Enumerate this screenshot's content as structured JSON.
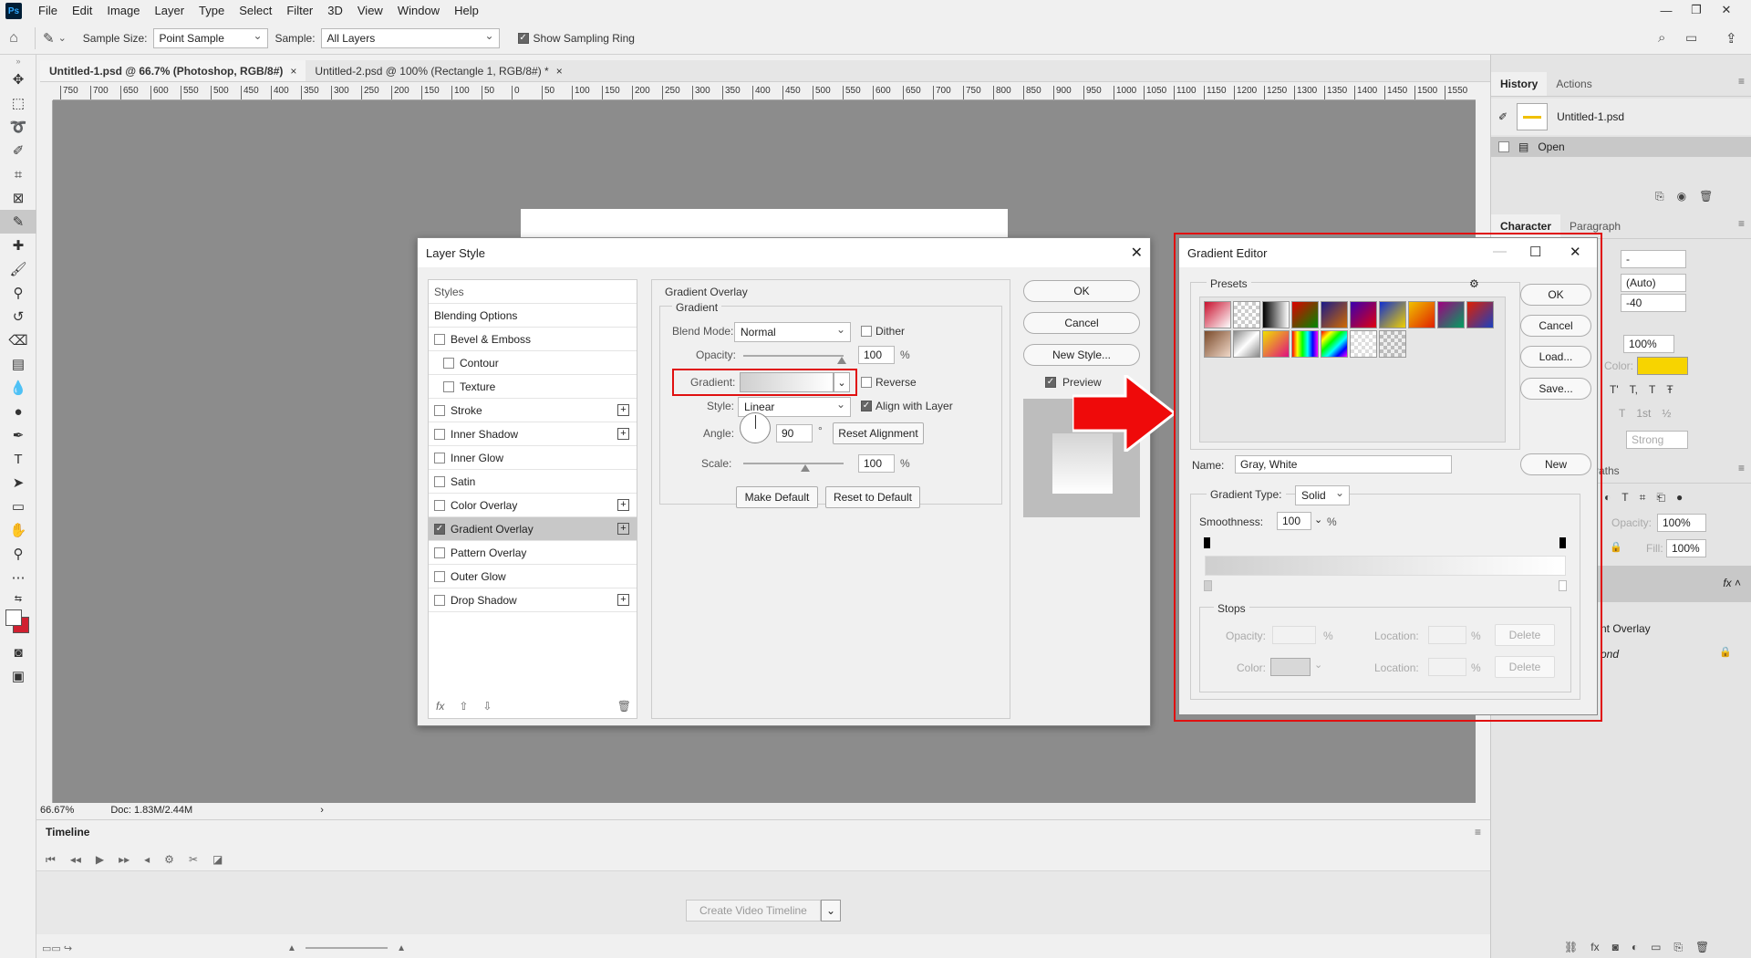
{
  "app": {
    "logo": "Ps",
    "menu": [
      "File",
      "Edit",
      "Image",
      "Layer",
      "Type",
      "Select",
      "Filter",
      "3D",
      "View",
      "Window",
      "Help"
    ]
  },
  "options_bar": {
    "sample_size_label": "Sample Size:",
    "sample_size_value": "Point Sample",
    "sample_label": "Sample:",
    "sample_value": "All Layers",
    "show_sampling_ring": "Show Sampling Ring"
  },
  "tabs": [
    {
      "label": "Untitled-1.psd @ 66.7% (Photoshop, RGB/8#)",
      "close": "×"
    },
    {
      "label": "Untitled-2.psd @ 100% (Rectangle 1, RGB/8#) *",
      "close": "×"
    }
  ],
  "ruler_ticks": [
    "750",
    "700",
    "650",
    "600",
    "550",
    "500",
    "450",
    "400",
    "350",
    "300",
    "250",
    "200",
    "150",
    "100",
    "50",
    "0",
    "50",
    "100",
    "150",
    "200",
    "250",
    "300",
    "350",
    "400",
    "450",
    "500",
    "550",
    "600",
    "650",
    "700",
    "750",
    "800",
    "850",
    "900",
    "950",
    "1000",
    "1050",
    "1100",
    "1150",
    "1200",
    "1250",
    "1300",
    "1350",
    "1400",
    "1450",
    "1500",
    "1550"
  ],
  "status": {
    "zoom": "66.67%",
    "doc": "Doc: 1.83M/2.44M"
  },
  "timeline": {
    "title": "Timeline",
    "create_video": "Create Video Timeline"
  },
  "history_panel": {
    "tabs": [
      "History",
      "Actions"
    ],
    "snapshot": "Untitled-1.psd",
    "step": "Open"
  },
  "character_panel": {
    "tabs": [
      "Character",
      "Paragraph"
    ],
    "font_style": "-",
    "leading": "(Auto)",
    "tracking": "-40",
    "vertical_scale": "100%",
    "color_label": "Color:",
    "color": "#f7d400",
    "antialias": "Strong"
  },
  "layers_panel": {
    "tabs_visible": "Paths",
    "opacity_label": "Opacity:",
    "opacity": "100%",
    "fill_label": "Fill:",
    "fill": "100%",
    "effect_label": "nt Overlay",
    "layer_label": "ond"
  },
  "layer_style": {
    "title": "Layer Style",
    "styles_header": "Styles",
    "blending_options": "Blending Options",
    "effects": [
      {
        "label": "Bevel & Emboss",
        "checked": false,
        "plus": false,
        "indent": false
      },
      {
        "label": "Contour",
        "checked": false,
        "plus": false,
        "indent": true
      },
      {
        "label": "Texture",
        "checked": false,
        "plus": false,
        "indent": true
      },
      {
        "label": "Stroke",
        "checked": false,
        "plus": true,
        "indent": false
      },
      {
        "label": "Inner Shadow",
        "checked": false,
        "plus": true,
        "indent": false
      },
      {
        "label": "Inner Glow",
        "checked": false,
        "plus": false,
        "indent": false
      },
      {
        "label": "Satin",
        "checked": false,
        "plus": false,
        "indent": false
      },
      {
        "label": "Color Overlay",
        "checked": false,
        "plus": true,
        "indent": false
      },
      {
        "label": "Gradient Overlay",
        "checked": true,
        "plus": true,
        "indent": false,
        "selected": true
      },
      {
        "label": "Pattern Overlay",
        "checked": false,
        "plus": false,
        "indent": false
      },
      {
        "label": "Outer Glow",
        "checked": false,
        "plus": false,
        "indent": false
      },
      {
        "label": "Drop Shadow",
        "checked": false,
        "plus": true,
        "indent": false
      }
    ],
    "section_title": "Gradient Overlay",
    "group_title": "Gradient",
    "blend_mode_label": "Blend Mode:",
    "blend_mode": "Normal",
    "dither": "Dither",
    "opacity_label": "Opacity:",
    "opacity": "100",
    "gradient_label": "Gradient:",
    "reverse": "Reverse",
    "style_label": "Style:",
    "style": "Linear",
    "align_with_layer": "Align with Layer",
    "angle_label": "Angle:",
    "angle": "90",
    "degree": "°",
    "reset_alignment": "Reset Alignment",
    "scale_label": "Scale:",
    "scale": "100",
    "percent": "%",
    "make_default": "Make Default",
    "reset_default": "Reset to Default",
    "ok": "OK",
    "cancel": "Cancel",
    "new_style": "New Style...",
    "preview": "Preview"
  },
  "gradient_editor": {
    "title": "Gradient Editor",
    "presets_label": "Presets",
    "ok": "OK",
    "cancel": "Cancel",
    "load": "Load...",
    "save": "Save...",
    "name_label": "Name:",
    "name": "Gray, White",
    "new": "New",
    "gradient_type_label": "Gradient Type:",
    "gradient_type": "Solid",
    "smoothness_label": "Smoothness:",
    "smoothness": "100",
    "percent": "%",
    "stops_label": "Stops",
    "opacity_label": "Opacity:",
    "color_label": "Color:",
    "location_label": "Location:",
    "delete": "Delete",
    "presets": [
      "linear-gradient(135deg,#c8102e,#fff)",
      "repeating-conic-gradient(#ccc 0 25%,#fff 0 50%) 0 0/8px 8px",
      "linear-gradient(90deg,#000,#fff)",
      "linear-gradient(135deg,#d00,#080)",
      "linear-gradient(135deg,#1a1a8a,#d06a00)",
      "linear-gradient(135deg,#3a00b0,#e00010)",
      "linear-gradient(135deg,#1030d0,#f0d000)",
      "linear-gradient(135deg,#f0c000,#e02000)",
      "linear-gradient(135deg,#a00080,#00a060)",
      "linear-gradient(135deg,#e02000,#1a40c0)",
      "linear-gradient(135deg,#7a4a2a,#f0d8c8)",
      "linear-gradient(135deg,#888,#fff,#888)",
      "linear-gradient(135deg,#f0e000,#e01080)",
      "linear-gradient(90deg,#f00,#ff0,#0f0,#0ff,#00f,#f0f)",
      "linear-gradient(135deg,#f00,#ff0,#0f0,#0ff,#00f,#f0f)",
      "repeating-conic-gradient(#ddd 0 25%,#fff 0 50%) 0 0/8px 8px",
      "repeating-conic-gradient(#bbb 0 25%,#eee 0 50%) 0 0/8px 8px"
    ]
  },
  "colors": {
    "highlight_red": "#e01010",
    "canvas": "#8c8c8c",
    "char_color_swatch": "#f7d400"
  }
}
